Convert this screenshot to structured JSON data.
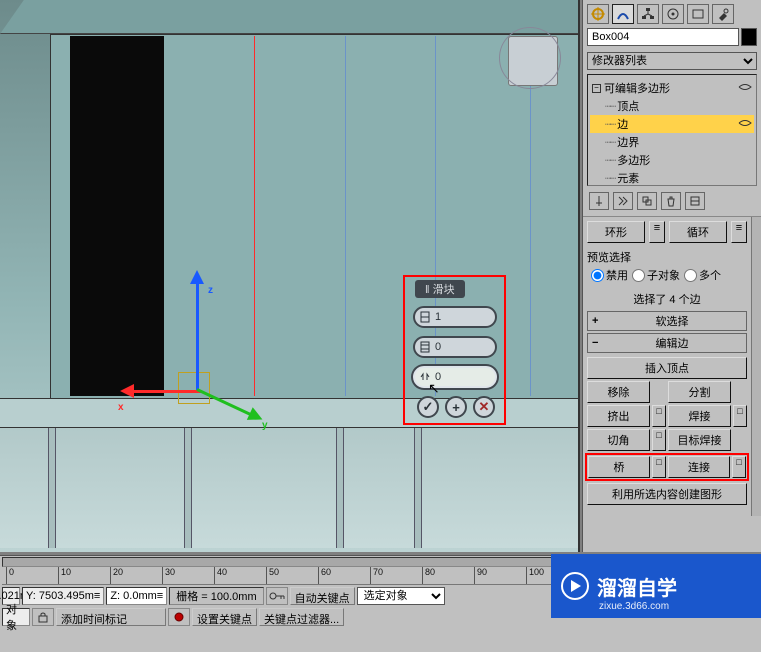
{
  "object_name": "Box004",
  "modifier_dropdown": "修改器列表",
  "modifier_tree": {
    "root": "可编辑多边形",
    "sub": [
      "顶点",
      "边",
      "边界",
      "多边形",
      "元素"
    ],
    "selected": "边"
  },
  "caddy": {
    "title": "‖ 滑块",
    "field1": "1",
    "field2": "0",
    "field3": "0"
  },
  "selection": {
    "ring": "环形",
    "loop": "循环",
    "preview_title": "预览选择",
    "radio_disable": "禁用",
    "radio_subobj": "子对象",
    "radio_multi": "多个",
    "count": "选择了 4 个边"
  },
  "rollouts": {
    "soft": "软选择",
    "edit_edge": "编辑边",
    "insert_vertex": "插入顶点",
    "remove": "移除",
    "split": "分割",
    "extrude": "挤出",
    "weld": "焊接",
    "chamfer": "切角",
    "target_weld": "目标焊接",
    "bridge": "桥",
    "connect": "连接",
    "create_shape": "利用所选内容创建图形"
  },
  "timeline": {
    "ticks": [
      "0",
      "10",
      "20",
      "30",
      "40",
      "50",
      "60",
      "70",
      "80",
      "90",
      "100"
    ]
  },
  "status": {
    "obj": "对象",
    "y_label": "Y:",
    "y_val": "7503.495m",
    "z_label": "Z:",
    "z_val": "0.0mm",
    "grid": "栅格 = 100.0mm",
    "auto_key": "自动关键点",
    "sel_target": "选定对象",
    "add_time": "添加时间标记",
    "set_key": "设置关键点",
    "key_filter": "关键点过滤器..."
  },
  "watermark": {
    "brand": "溜溜自学",
    "url": "zixue.3d66.com"
  }
}
